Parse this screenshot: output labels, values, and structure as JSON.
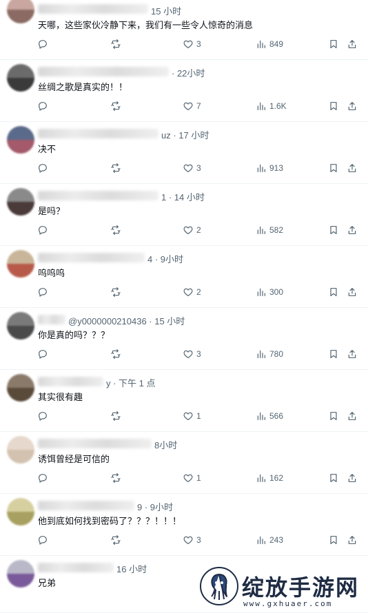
{
  "tweets": [
    {
      "time": "15 小时",
      "text": "天哪，这些家伙冷静下来，我们有一些令人惊奇的消息",
      "replies": "",
      "retweets": "",
      "likes": "3",
      "views": "849",
      "avatar": [
        "#c9a7a0",
        "#8a6a62"
      ]
    },
    {
      "time": "· 22小时",
      "text": "丝绸之歌是真实的！！",
      "replies": "",
      "retweets": "",
      "likes": "7",
      "views": "1.6K",
      "avatar": [
        "#6b6b6b",
        "#3a3a3a"
      ]
    },
    {
      "time": "uz · 17 小时",
      "text": "决不",
      "replies": "",
      "retweets": "",
      "likes": "3",
      "views": "913",
      "avatar": [
        "#5a6a8a",
        "#a45a6a"
      ]
    },
    {
      "time": "1 · 14 小时",
      "text": "是吗？",
      "replies": "",
      "retweets": "",
      "likes": "2",
      "views": "582",
      "avatar": [
        "#8a8a8a",
        "#4a3a3a"
      ]
    },
    {
      "time": "4 · 9小时",
      "text": "呜呜呜",
      "replies": "",
      "retweets": "",
      "likes": "2",
      "views": "300",
      "avatar": [
        "#c9b59a",
        "#b85a4a"
      ]
    },
    {
      "time": "@y0000000210436 · 15 小时",
      "text": "你是真的吗？？？",
      "replies": "",
      "retweets": "",
      "likes": "3",
      "views": "780",
      "avatar": [
        "#7a7a7a",
        "#4a4a4a"
      ]
    },
    {
      "time": "y · 下午 1 点",
      "text": "其实很有趣",
      "replies": "",
      "retweets": "",
      "likes": "1",
      "views": "566",
      "avatar": [
        "#8a7a6a",
        "#5a4a3a"
      ]
    },
    {
      "time": "8小时",
      "text": "诱饵曾经是可信的",
      "replies": "",
      "retweets": "",
      "likes": "1",
      "views": "162",
      "avatar": [
        "#e6d8cc",
        "#d4c2b0"
      ]
    },
    {
      "time": "9 · 9小时",
      "text": "他到底如何找到密码了？？？！！！",
      "replies": "",
      "retweets": "",
      "likes": "3",
      "views": "243",
      "avatar": [
        "#d6d0a0",
        "#a8a060"
      ]
    },
    {
      "time": "16 小时",
      "text": "兄弟",
      "replies": "",
      "retweets": "",
      "likes": "",
      "views": "",
      "avatar": [
        "#b8b8c8",
        "#7a5a9a"
      ]
    }
  ],
  "watermark": {
    "title": "绽放手游网",
    "url": "www.gxhuaer.com"
  },
  "colors": {
    "text": "#0f1419",
    "secondary": "#536471",
    "divider": "#eff3f4",
    "watermark": "#1e2b44"
  },
  "icons": {
    "reply": "reply-icon",
    "retweet": "retweet-icon",
    "like": "heart-icon",
    "views": "views-chart-icon",
    "bookmark": "bookmark-icon",
    "share": "share-icon"
  }
}
